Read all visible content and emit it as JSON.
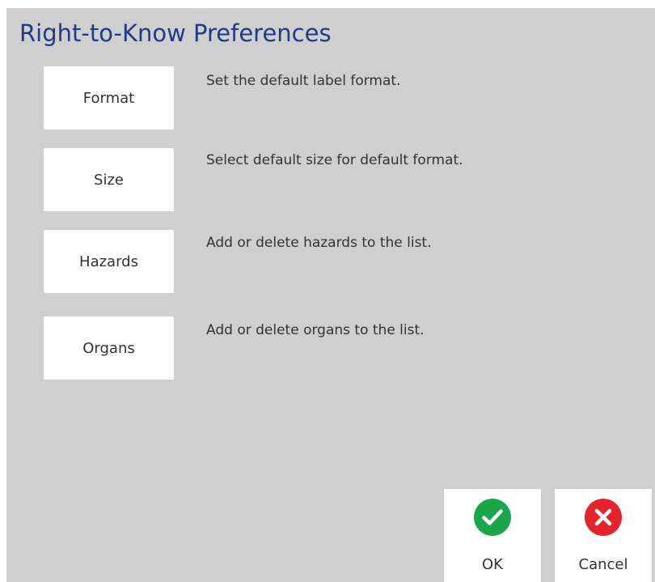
{
  "dialog": {
    "title": "Right-to-Know Preferences"
  },
  "preferences": [
    {
      "label": "Format",
      "description": "Set the default label format."
    },
    {
      "label": "Size",
      "description": "Select default size for default format."
    },
    {
      "label": "Hazards",
      "description": "Add or delete hazards to the list."
    },
    {
      "label": "Organs",
      "description": "Add or delete organs to the list."
    }
  ],
  "actions": {
    "ok": {
      "label": "OK",
      "icon": "check-icon",
      "color": "#1aa64a"
    },
    "cancel": {
      "label": "Cancel",
      "icon": "close-icon",
      "color": "#e5232c"
    }
  },
  "colors": {
    "title": "#1f3b87",
    "background": "#cfcfcf"
  }
}
